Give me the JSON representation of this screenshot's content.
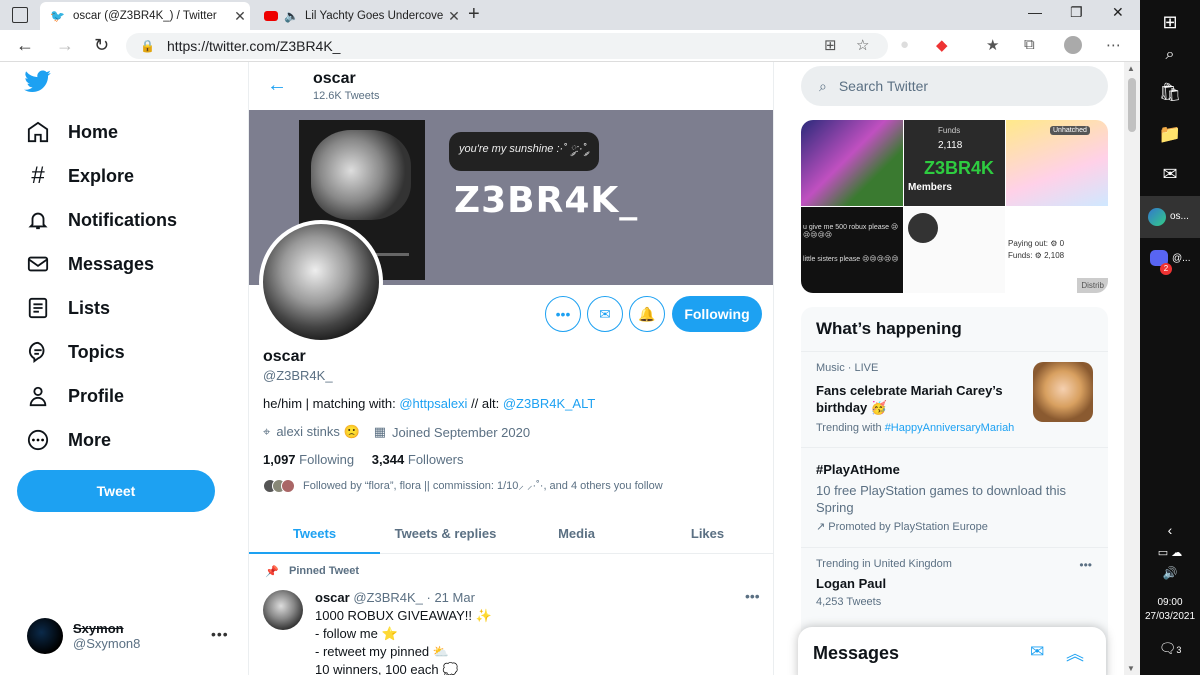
{
  "browser": {
    "tabs": [
      {
        "title": "oscar (@Z3BR4K_) / Twitter",
        "active": true
      },
      {
        "title": "Lil Yachty Goes Undercover",
        "active": false
      }
    ],
    "url": "https://twitter.com/Z3BR4K_"
  },
  "nav": {
    "items": [
      "Home",
      "Explore",
      "Notifications",
      "Messages",
      "Lists",
      "Topics",
      "Profile",
      "More"
    ],
    "tweet_button": "Tweet",
    "account": {
      "name": "Sxymon",
      "handle": "@Sxymon8"
    }
  },
  "profile": {
    "header_name": "oscar",
    "tweet_count": "12.6K Tweets",
    "banner": {
      "bubble": "you're my sunshine :·˚ ༘:·˚ ༘",
      "tag": "Z3BR4K_"
    },
    "follow_label": "Following",
    "name": "oscar",
    "handle": "@Z3BR4K_",
    "bio_prefix": "he/him | matching with: ",
    "bio_link1": "@httpsalexi",
    "bio_mid": " // alt: ",
    "bio_link2": "@Z3BR4K_ALT",
    "location": "alexi stinks 🙁",
    "joined": "Joined September 2020",
    "following_count": "1,097",
    "following_label": "Following",
    "followers_count": "3,344",
    "followers_label": "Followers",
    "followed_by": "Followed by “flora”, flora || commission: 1/10⸝ ⸝·˚·, and 4 others you follow",
    "tabs": [
      "Tweets",
      "Tweets & replies",
      "Media",
      "Likes"
    ]
  },
  "pinned_tweet": {
    "label": "Pinned Tweet",
    "name": "oscar",
    "handle_date": "@Z3BR4K_ · 21 Mar",
    "lines": [
      "1000 ROBUX GIVEAWAY!! ✨",
      "- follow me ⭐",
      "- retweet my pinned ⛅",
      "10 winners, 100 each 💭"
    ]
  },
  "sidebar": {
    "search_placeholder": "Search Twitter",
    "media": {
      "funds_label": "Funds",
      "funds_value": "2,118",
      "z3br4k": "Z3BR4K",
      "members": "Members",
      "unhatched": "Unhatched",
      "msg1": "u give me 500 robux please 😢😢😢😢😢",
      "msg2": "little sisters please 😢😢😢😢😢",
      "paying": "Paying out: ⚙ 0",
      "funds2": "Funds: ⚙ 2,108",
      "distrib": "Distrib"
    },
    "happening_title": "What’s happening",
    "trends": [
      {
        "category": "Music · LIVE",
        "title": "Fans celebrate Mariah Carey’s birthday 🥳",
        "trending_with": "Trending with",
        "hashtag": "#HappyAnniversaryMariah"
      },
      {
        "title": "#PlayAtHome",
        "description": "10 free PlayStation games to download this Spring",
        "promoted": "Promoted by PlayStation Europe"
      },
      {
        "category": "Trending in United Kingdom",
        "title": "Logan Paul",
        "count": "4,253 Tweets"
      }
    ],
    "messages_title": "Messages"
  },
  "taskbar": {
    "edge_label": "os...",
    "discord_label": "@...",
    "discord_badge": "2",
    "time": "09:00",
    "date": "27/03/2021",
    "notif_count": "3"
  },
  "colors": {
    "accent": "#1da1f2",
    "text": "#0f1419",
    "muted": "#5b7083"
  }
}
